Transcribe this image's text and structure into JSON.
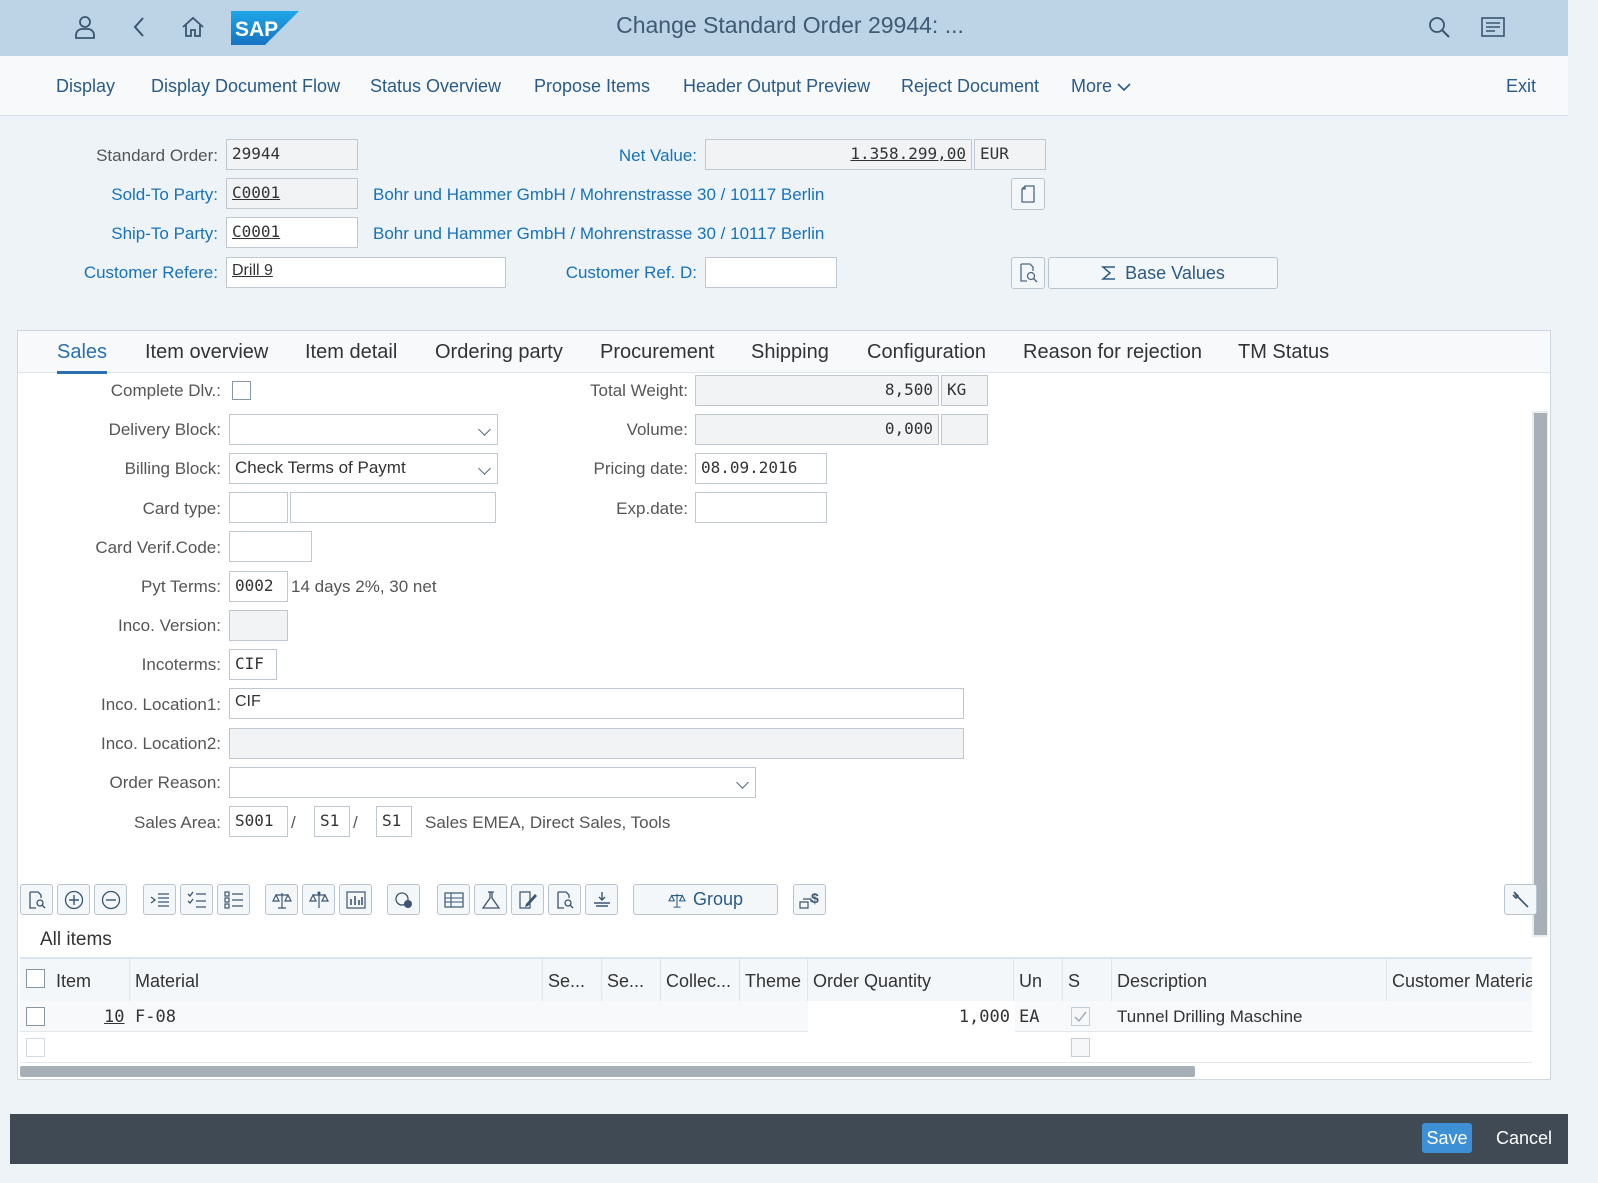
{
  "shell": {
    "title": "Change Standard Order 29944: ...",
    "logo": "SAP",
    "icons": [
      "user-icon",
      "back-icon",
      "home-icon",
      "search-icon",
      "menu-icon"
    ]
  },
  "toolbar": {
    "display": "Display",
    "doc_flow": "Display Document Flow",
    "status": "Status Overview",
    "propose": "Propose Items",
    "output": "Header Output Preview",
    "reject": "Reject Document",
    "more": "More",
    "exit": "Exit"
  },
  "header": {
    "std_order_label": "Standard Order:",
    "std_order_value": "29944",
    "net_value_label": "Net Value:",
    "net_value": "1.358.299,00",
    "currency": "EUR",
    "soldto_label": "Sold-To Party:",
    "soldto_value": "C0001",
    "soldto_desc": "Bohr und Hammer GmbH / Mohrenstrasse 30 / 10117 Berlin",
    "shipto_label": "Ship-To Party:",
    "shipto_value": "C0001",
    "shipto_desc": "Bohr und Hammer GmbH / Mohrenstrasse 30 / 10117 Berlin",
    "custref_label": "Customer Refere:",
    "custref_value": "Drill 9",
    "custrefd_label": "Customer Ref. D:",
    "custrefd_value": "",
    "base_values": "Base Values"
  },
  "tabs": [
    "Sales",
    "Item overview",
    "Item detail",
    "Ordering party",
    "Procurement",
    "Shipping",
    "Configuration",
    "Reason for rejection",
    "TM Status"
  ],
  "sales": {
    "complete_dlv_label": "Complete Dlv.:",
    "delivery_block_label": "Delivery Block:",
    "delivery_block_value": "",
    "billing_block_label": "Billing Block:",
    "billing_block_value": "Check Terms of Paymt",
    "card_type_label": "Card type:",
    "card_verif_label": "Card Verif.Code:",
    "pyt_terms_label": "Pyt Terms:",
    "pyt_terms_value": "0002",
    "pyt_terms_desc": "14 days 2%, 30 net",
    "inco_version_label": "Inco. Version:",
    "incoterms_label": "Incoterms:",
    "incoterms_value": "CIF",
    "inco_loc1_label": "Inco. Location1:",
    "inco_loc1_value": "CIF",
    "inco_loc2_label": "Inco. Location2:",
    "order_reason_label": "Order Reason:",
    "sales_area_label": "Sales Area:",
    "sales_org": "S001",
    "dist_channel": "S1",
    "division": "S1",
    "sales_area_desc": "Sales EMEA, Direct Sales, Tools",
    "slash": "/",
    "total_weight_label": "Total Weight:",
    "total_weight_value": "8,500",
    "weight_unit": "KG",
    "volume_label": "Volume:",
    "volume_value": "0,000",
    "pricing_date_label": "Pricing date:",
    "pricing_date_value": "08.09.2016",
    "exp_date_label": "Exp.date:"
  },
  "items": {
    "section_title": "All items",
    "group_button": "Group",
    "columns": [
      "Item",
      "Material",
      "Se...",
      "Se...",
      "Collec...",
      "Theme",
      "Order Quantity",
      "Un",
      "S",
      "Description",
      "Customer Material"
    ],
    "rows": [
      {
        "item": "10",
        "material": "F-08",
        "order_qty": "1,000",
        "unit": "EA",
        "description": "Tunnel Drilling Maschine"
      }
    ]
  },
  "footer": {
    "save": "Save",
    "cancel": "Cancel"
  },
  "colors": {
    "shell_bg": "#bdd3e6",
    "link": "#1772bb",
    "primary_button": "#3d90d6",
    "footer_bg": "#3f4a54"
  }
}
